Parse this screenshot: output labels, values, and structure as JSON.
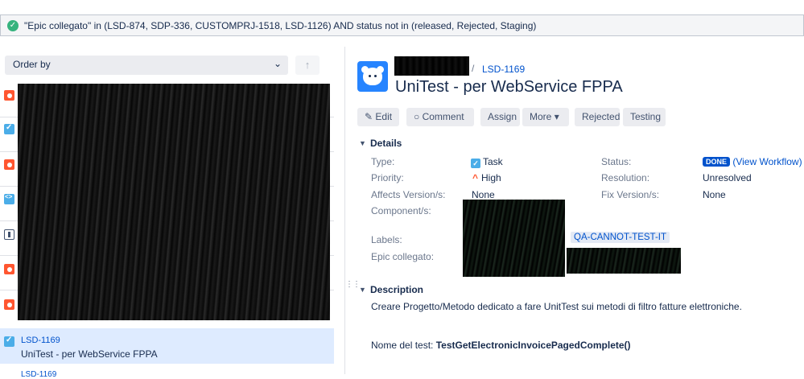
{
  "filter": {
    "query": "\"Epic collegato\" in (LSD-874, SDP-336, CUSTOMPRJ-1518, LSD-1126) AND status not in (released, Rejected, Staging)"
  },
  "list": {
    "order_by_label": "Order by",
    "issue_types": [
      "bug",
      "task",
      "bug",
      "subtask",
      "story",
      "bug",
      "bug"
    ],
    "selected": {
      "key": "LSD-1169",
      "summary": "UniTest - per WebService FPPA"
    },
    "next_key": "LSD-1169"
  },
  "issue": {
    "breadcrumb_sep": "/",
    "key": "LSD-1169",
    "title": "UniTest - per WebService FPPA",
    "actions": {
      "edit": "Edit",
      "comment": "Comment",
      "assign": "Assign",
      "more": "More",
      "rejected": "Rejected",
      "testing": "Testing"
    },
    "details": {
      "heading": "Details",
      "type_label": "Type:",
      "type_value": "Task",
      "priority_label": "Priority:",
      "priority_value": "High",
      "affects_label": "Affects Version/s:",
      "affects_value": "None",
      "component_label": "Component/s:",
      "labels_label": "Labels:",
      "label_chip": "QA-CANNOT-TEST-IT",
      "epic_label": "Epic collegato:",
      "status_label": "Status:",
      "status_value": "DONE",
      "view_workflow": "(View Workflow)",
      "resolution_label": "Resolution:",
      "resolution_value": "Unresolved",
      "fix_label": "Fix Version/s:",
      "fix_value": "None"
    },
    "description": {
      "heading": "Description",
      "text": "Creare Progetto/Metodo dedicato a fare UnitTest sui metodi di filtro fatture elettroniche.",
      "test_name_label": "Nome del test:",
      "test_name_value": "TestGetElectronicInvoicePagedComplete()"
    }
  },
  "colors": {
    "accent": "#0052cc",
    "done": "#0052cc",
    "success": "#36b37e",
    "selected_bg": "#deebff"
  }
}
